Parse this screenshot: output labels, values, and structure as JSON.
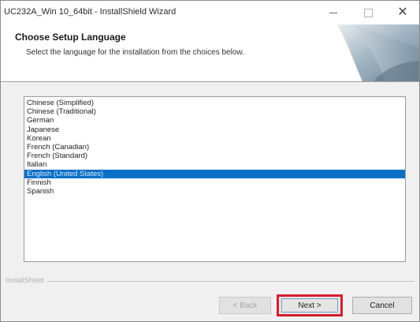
{
  "window": {
    "title": "UC232A_Win 10_64bit - InstallShield Wizard",
    "minimize_icon": "minimize-icon",
    "maximize_icon": "maximize-icon",
    "close_icon": "close-icon",
    "close_glyph": "✕"
  },
  "header": {
    "title": "Choose Setup Language",
    "subtitle": "Select the language for the installation from the choices below."
  },
  "languages": {
    "selected": "English (United States)",
    "items": [
      "Chinese (Simplified)",
      "Chinese (Traditional)",
      "German",
      "Japanese",
      "Korean",
      "French (Canadian)",
      "French (Standard)",
      "Italian",
      "English (United States)",
      "Finnish",
      "Spanish"
    ]
  },
  "footer": {
    "brand": "InstallShield",
    "back_label": "< Back",
    "next_label": "Next >",
    "cancel_label": "Cancel"
  },
  "colors": {
    "selection": "#0a6fc8",
    "highlight_border": "#d21f2e"
  }
}
